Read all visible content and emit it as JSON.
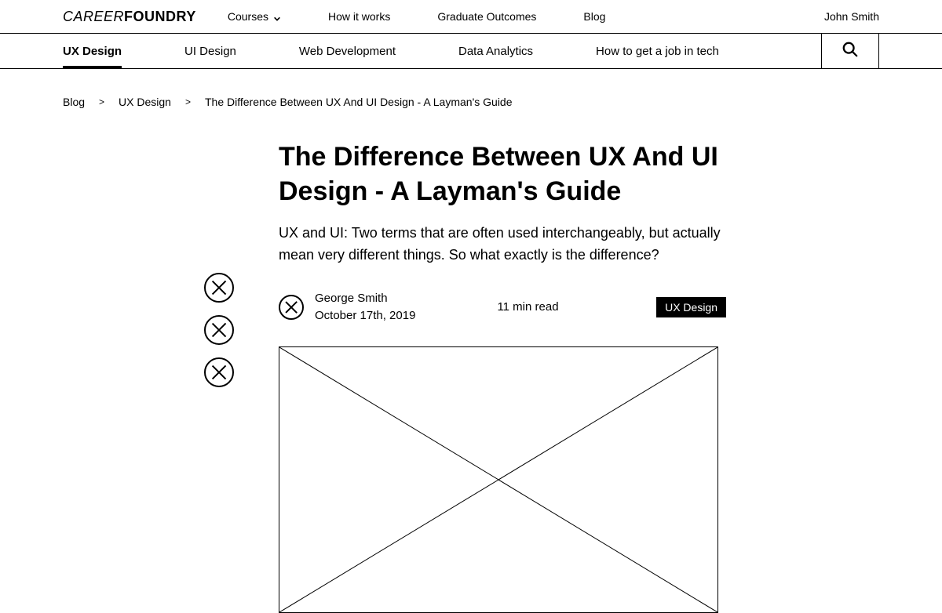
{
  "header": {
    "logo_thin": "CAREER",
    "logo_bold": "FOUNDRY",
    "nav": {
      "courses": "Courses",
      "how_it_works": "How it works",
      "graduate_outcomes": "Graduate Outcomes",
      "blog": "Blog"
    },
    "user_name": "John Smith"
  },
  "subnav": {
    "tabs": [
      "UX Design",
      "UI Design",
      "Web Development",
      "Data Analytics",
      "How to get a job in tech"
    ],
    "active_index": 0,
    "search_icon": "search-icon"
  },
  "breadcrumb": {
    "items": [
      "Blog",
      "UX Design",
      "The Difference Between UX And UI Design - A Layman's Guide"
    ],
    "separator": ">"
  },
  "share_icons": [
    "share-1",
    "share-2",
    "share-3"
  ],
  "article": {
    "title": "The Difference Between UX And UI Design - A Layman's Guide",
    "lede": "UX and UI: Two terms that are often used interchangeably, but actually mean very different things. So what exactly is the difference?",
    "author": {
      "name": "George Smith",
      "date": "October 17th, 2019",
      "avatar_icon": "avatar-placeholder"
    },
    "read_time": "11 min read",
    "category": "UX Design"
  }
}
